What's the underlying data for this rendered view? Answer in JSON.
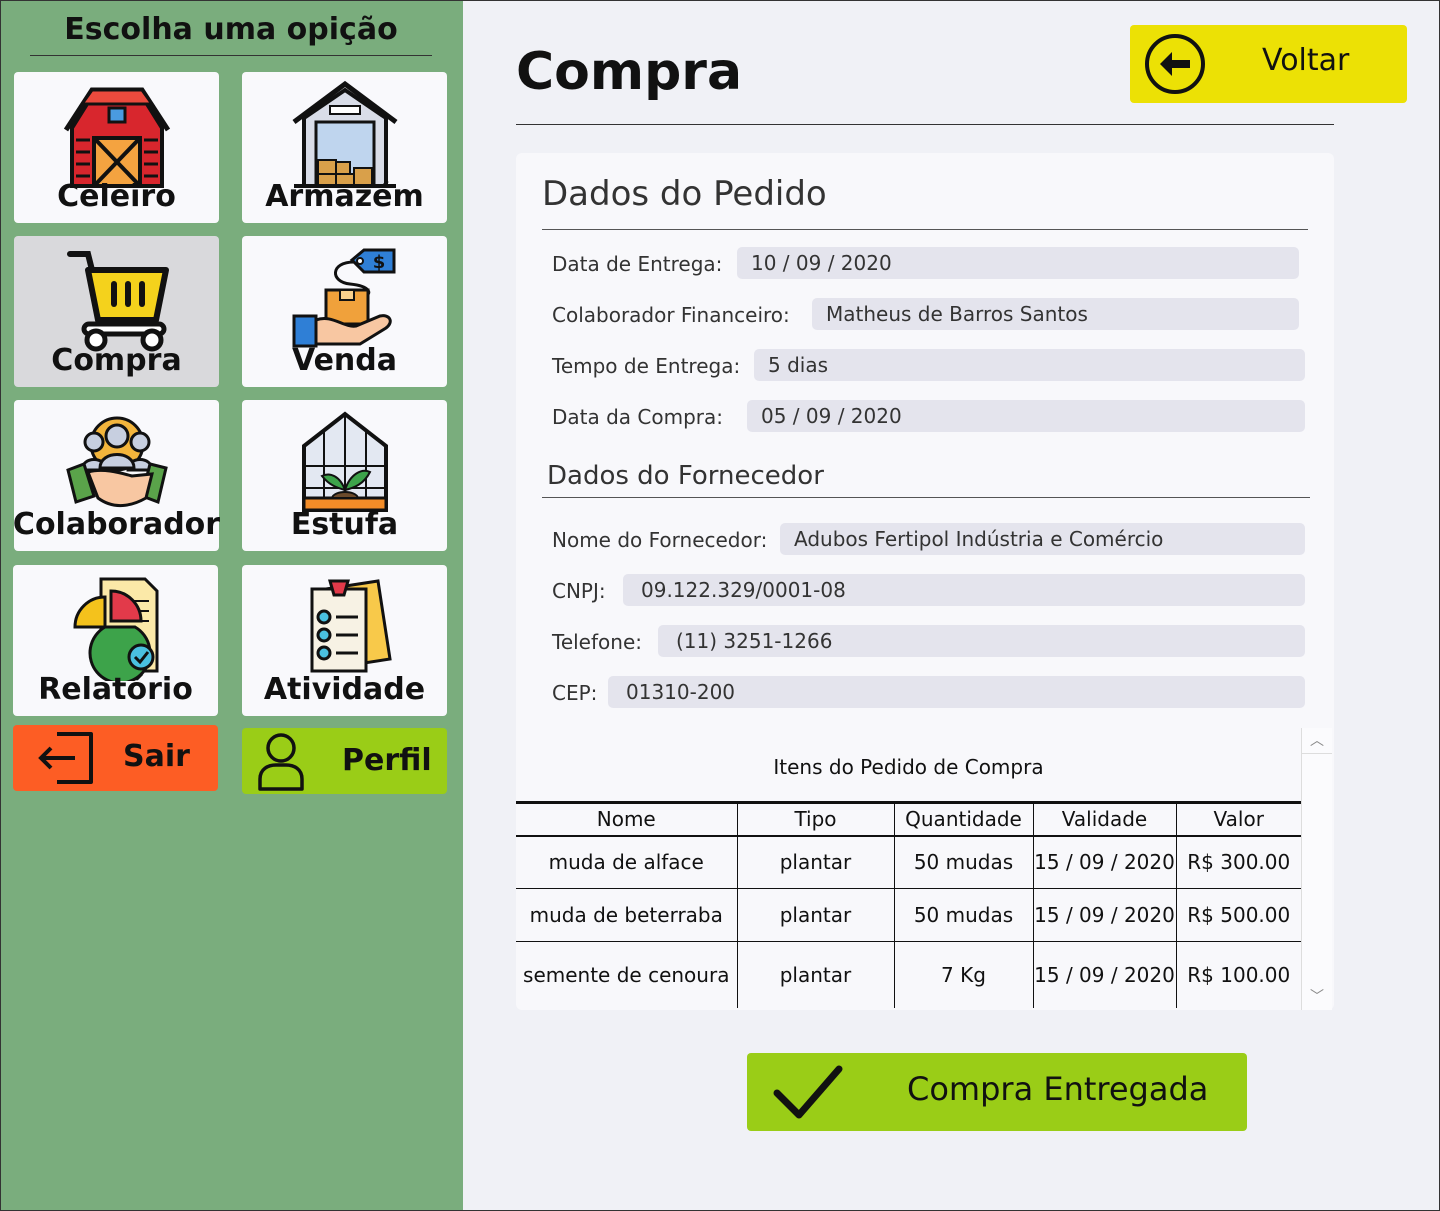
{
  "sidebar": {
    "title": "Escolha uma opição",
    "tiles": [
      {
        "label": "Celeiro",
        "icon": "barn-icon"
      },
      {
        "label": "Armazém",
        "icon": "warehouse-icon"
      },
      {
        "label": "Compra",
        "icon": "shopping-cart-icon"
      },
      {
        "label": "Venda",
        "icon": "sale-hand-icon"
      },
      {
        "label": "Colaborador",
        "icon": "handshake-icon"
      },
      {
        "label": "Estufa",
        "icon": "greenhouse-icon"
      },
      {
        "label": "Relatório",
        "icon": "report-chart-icon"
      },
      {
        "label": "Atividade",
        "icon": "checklist-icon"
      }
    ],
    "sair_label": "Sair",
    "perfil_label": "Perfil"
  },
  "header": {
    "title": "Compra",
    "back_label": "Voltar"
  },
  "pedido": {
    "title": "Dados do Pedido",
    "data_entrega_label": "Data de Entrega:",
    "data_entrega": "10 / 09 / 2020",
    "colaborador_label": "Colaborador Financeiro:",
    "colaborador": "Matheus de Barros Santos",
    "tempo_label": "Tempo de Entrega:",
    "tempo": "5 dias",
    "data_compra_label": "Data da Compra:",
    "data_compra": "05 / 09 / 2020"
  },
  "fornecedor": {
    "title": "Dados do Fornecedor",
    "nome_label": "Nome do Fornecedor:",
    "nome": "Adubos Fertipol Indústria e Comércio",
    "cnpj_label": "CNPJ:",
    "cnpj": "09.122.329/0001-08",
    "telefone_label": "Telefone:",
    "telefone": "(11) 3251-1266",
    "cep_label": "CEP:",
    "cep": "01310-200"
  },
  "itens": {
    "caption": "Itens do Pedido de Compra",
    "columns": [
      "Nome",
      "Tipo",
      "Quantidade",
      "Validade",
      "Valor"
    ],
    "rows": [
      [
        "muda de alface",
        "plantar",
        "50 mudas",
        "15 / 09 / 2020",
        "R$ 300.00"
      ],
      [
        "muda de beterraba",
        "plantar",
        "50 mudas",
        "15 / 09 / 2020",
        "R$ 500.00"
      ],
      [
        "semente de cenoura",
        "plantar",
        "7 Kg",
        "15 / 09 / 2020",
        "R$ 100.00"
      ]
    ]
  },
  "confirm_label": "Compra Entregada",
  "colors": {
    "sidebar": "#7aad7d",
    "yellow": "#ece105",
    "green": "#9acd17",
    "orange": "#fd5d24"
  }
}
